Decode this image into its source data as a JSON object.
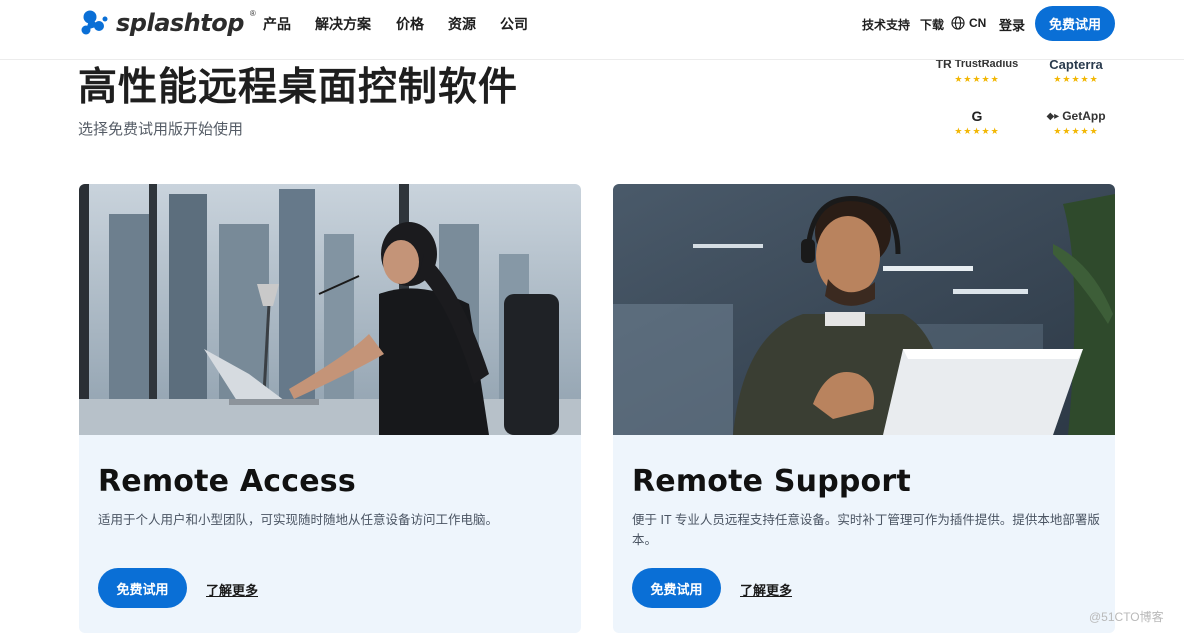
{
  "brand": {
    "name": "splashtop",
    "reg": "®",
    "color": "#0a6fd6"
  },
  "nav": {
    "items": [
      "产品",
      "解决方案",
      "价格",
      "资源",
      "公司"
    ]
  },
  "utility": {
    "support": "技术支持",
    "download": "下载",
    "language": "CN",
    "login": "登录",
    "trial": "免费试用"
  },
  "hero": {
    "title": "高性能远程桌面控制软件",
    "subtitle": "选择免费试用版开始使用"
  },
  "ratings": [
    {
      "name": "TrustRadius",
      "stars": "★★★★★"
    },
    {
      "name": "Capterra",
      "stars": "★★★★★"
    },
    {
      "name": "G",
      "stars": "★★★★★"
    },
    {
      "name": "GetApp",
      "stars": "★★★★★"
    }
  ],
  "cards": [
    {
      "title": "Remote Access",
      "description": "适用于个人用户和小型团队，可实现随时随地从任意设备访问工作电脑。",
      "button": "免费试用",
      "link": "了解更多"
    },
    {
      "title": "Remote Support",
      "description": "便于 IT 专业人员远程支持任意设备。实时补丁管理可作为插件提供。提供本地部署版本。",
      "button": "免费试用",
      "link": "了解更多"
    }
  ],
  "watermark": "@51CTO博客"
}
